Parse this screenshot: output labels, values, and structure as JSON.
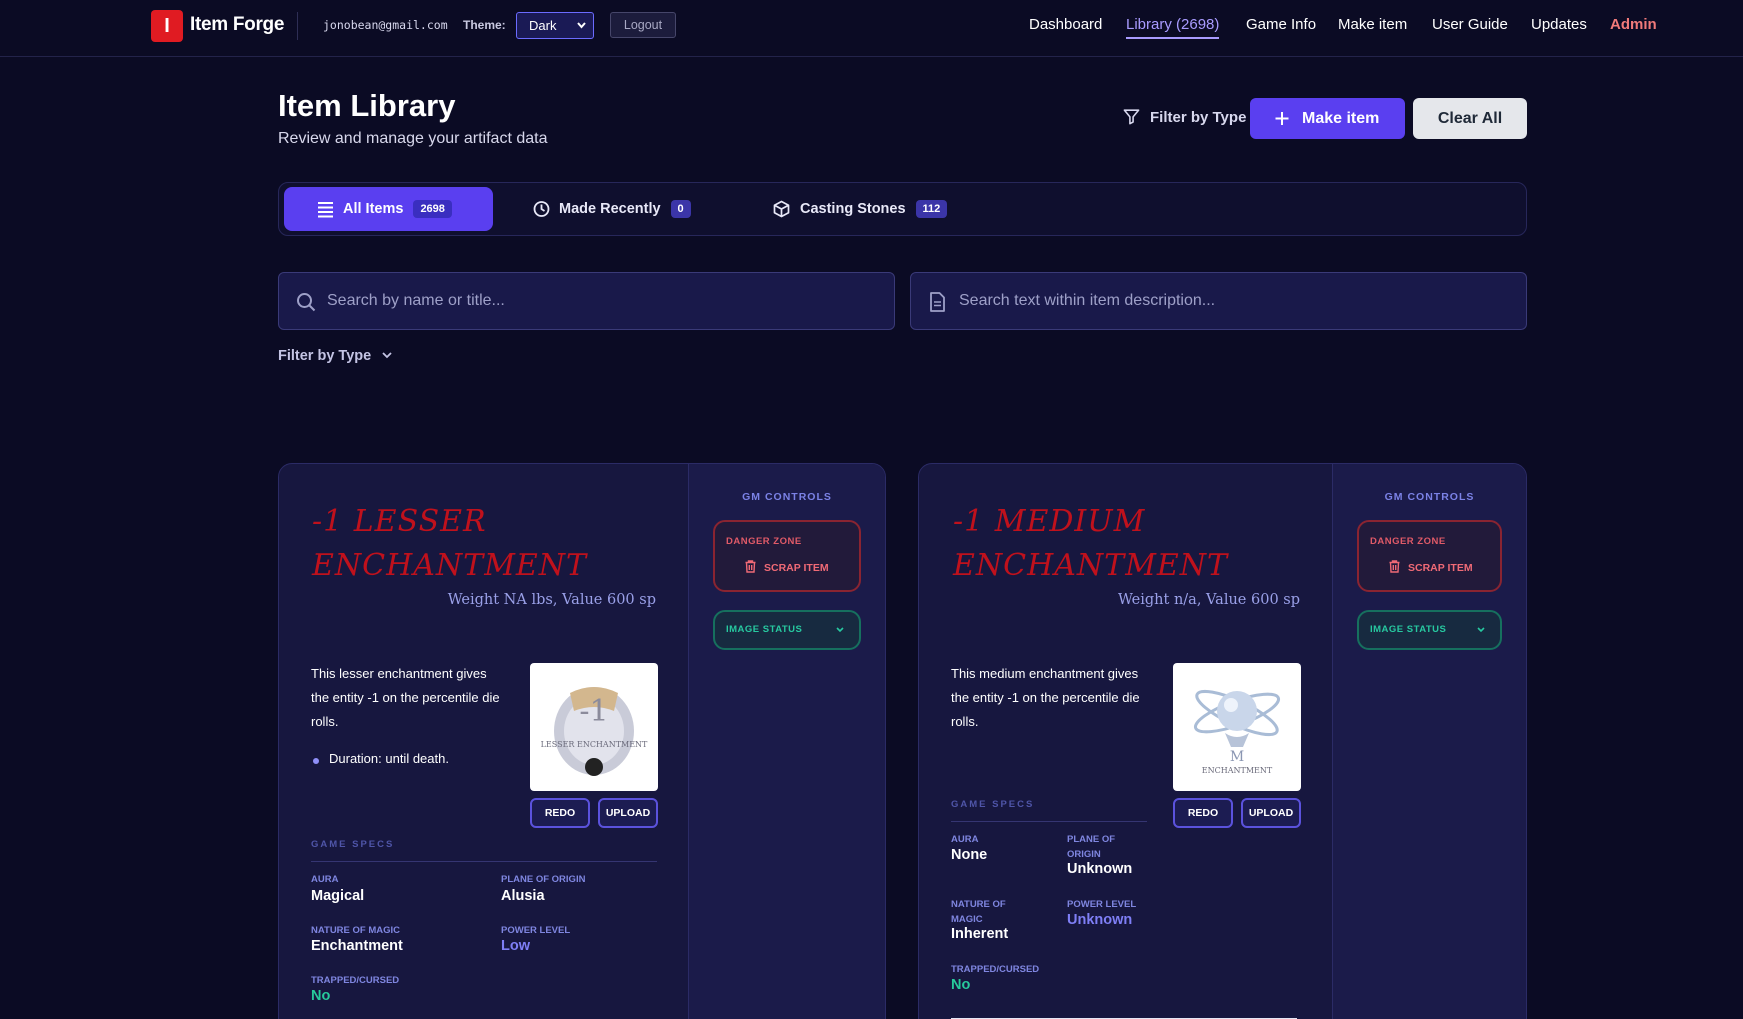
{
  "nav": {
    "logo_letter": "I",
    "brand": "Item Forge",
    "email": "jonobean@gmail.com",
    "theme_label": "Theme:",
    "theme_value": "Dark",
    "logout_label": "Logout",
    "links": [
      "Dashboard",
      "Library (2698)",
      "Game Info",
      "Make item",
      "User Guide",
      "Updates",
      "Admin"
    ],
    "active_link": "Library (2698)"
  },
  "header": {
    "title": "Item Library",
    "subtitle": "Review and manage your artifact data",
    "filter_label": "Filter by Type",
    "make_label": "Make item",
    "clear_label": "Clear All"
  },
  "tabs": [
    {
      "label": "All Items",
      "count": "2698",
      "active": true
    },
    {
      "label": "Made Recently",
      "count": "0",
      "active": false
    },
    {
      "label": "Casting Stones",
      "count": "112",
      "active": false
    }
  ],
  "search": {
    "name_placeholder": "Search by name or title...",
    "desc_placeholder": "Search text within item description..."
  },
  "filter_type_label": "Filter by Type",
  "colors": {
    "accent": "#5a3ff0",
    "danger": "#e05a68",
    "success": "#27c99b",
    "item_title": "#c0111c"
  },
  "cards": [
    {
      "title_line1": "-1 Lesser",
      "title_line2": "Enchantment",
      "weight": "Weight NA lbs, Value 600 sp",
      "description": "This lesser enchantment gives the entity -1 on the percentile die rolls.",
      "bullet": "Duration: until death.",
      "thumb_text_top": "-1",
      "thumb_text_bottom": "LESSER ENCHANTMENT",
      "redo_label": "REDO",
      "upload_label": "UPLOAD",
      "specs_title": "GAME SPECS",
      "specs": {
        "aura_label": "AURA",
        "aura": "Magical",
        "plane_label": "PLANE OF ORIGIN",
        "plane": "Alusia",
        "nature_label": "NATURE OF MAGIC",
        "nature": "Enchantment",
        "power_label": "POWER LEVEL",
        "power": "Low",
        "trapped_label": "TRAPPED/CURSED",
        "trapped": "No"
      },
      "gm": {
        "title": "GM CONTROLS",
        "danger_title": "DANGER ZONE",
        "scrap_label": "SCRAP ITEM",
        "image_status_label": "IMAGE STATUS"
      }
    },
    {
      "title_line1": "-1 Medium",
      "title_line2": "Enchantment",
      "weight": "Weight n/a, Value 600 sp",
      "description": "This medium enchantment gives the entity -1 on the percentile die rolls.",
      "thumb_text_top": "M",
      "thumb_text_bottom": "ENCHANTMENT",
      "redo_label": "REDO",
      "upload_label": "UPLOAD",
      "specs_title": "GAME SPECS",
      "specs": {
        "aura_label": "AURA",
        "aura": "None",
        "plane_label": "PLANE OF ORIGIN",
        "plane": "Unknown",
        "nature_label": "NATURE OF MAGIC",
        "nature": "Inherent",
        "power_label": "POWER LEVEL",
        "power": "Unknown",
        "trapped_label": "TRAPPED/CURSED",
        "trapped": "No"
      },
      "gm": {
        "title": "GM CONTROLS",
        "danger_title": "DANGER ZONE",
        "scrap_label": "SCRAP ITEM",
        "image_status_label": "IMAGE STATUS"
      }
    }
  ]
}
